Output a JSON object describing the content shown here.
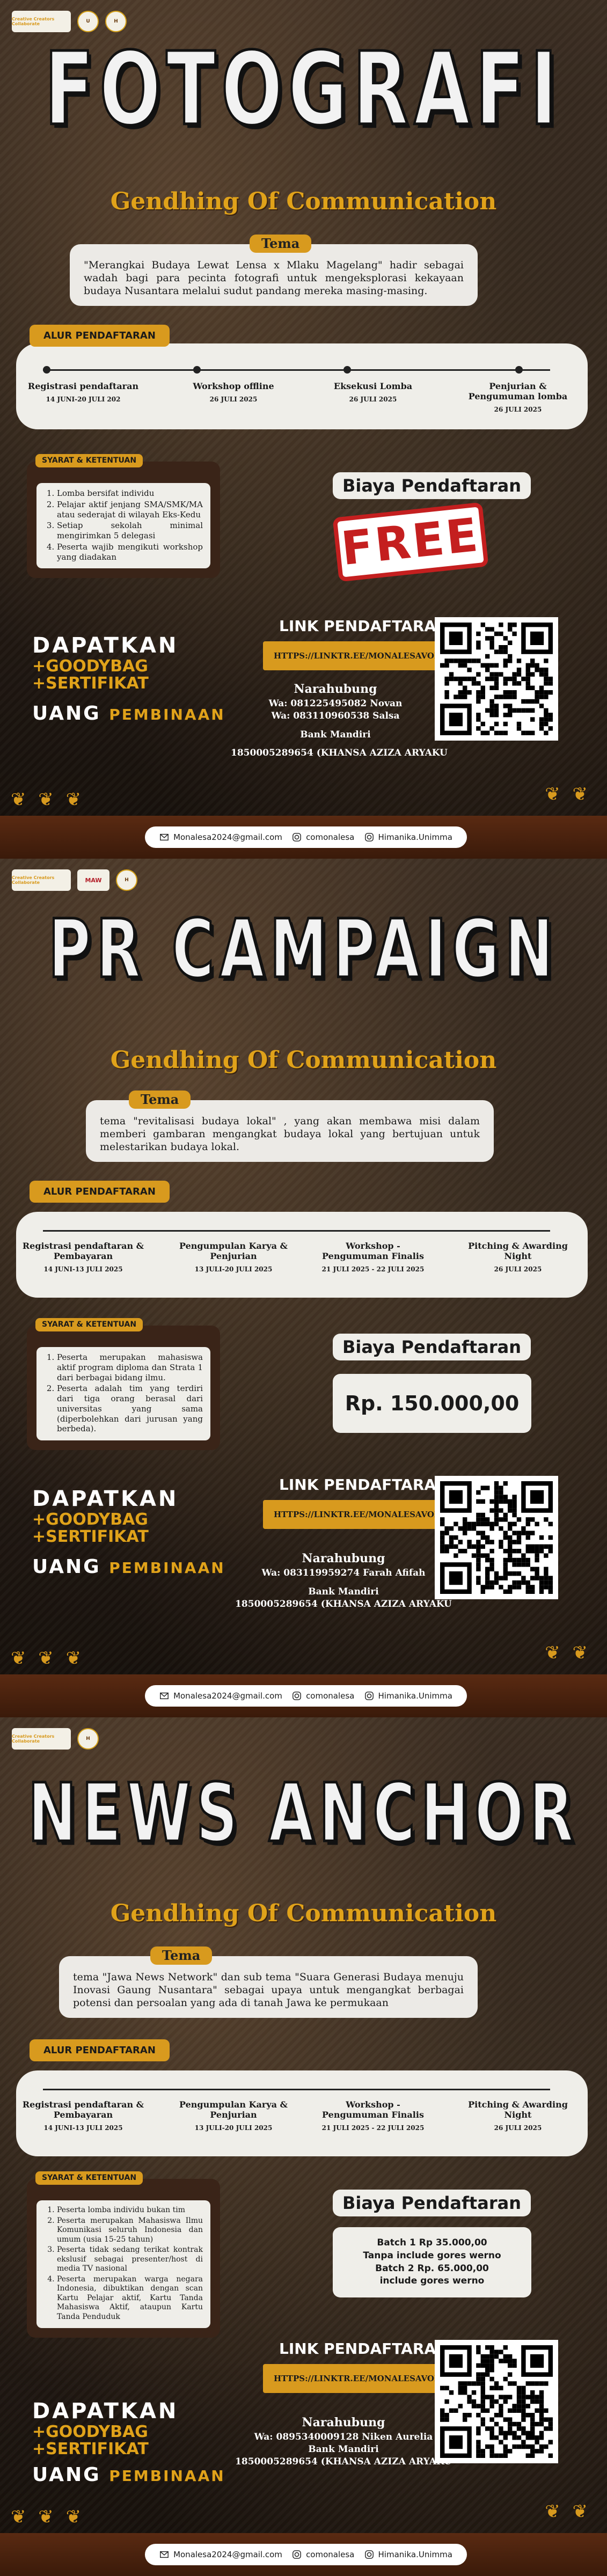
{
  "logos": {
    "creative_label": "Creative Creators Collaborate",
    "maw_label": "MAW"
  },
  "posters": [
    {
      "title": "FOTOGRAFI",
      "subtitle": "Gendhing Of Communication",
      "tema_label": "Tema",
      "tema_text": "\"Merangkai Budaya Lewat Lensa x Mlaku Magelang\" hadir sebagai wadah bagi para pecinta fotografi untuk mengeksplorasi kekayaan budaya Nusantara melalui sudut pandang mereka masing-masing.",
      "alur_label": "ALUR PENDAFTARAN",
      "steps": [
        {
          "name": "Registrasi pendaftaran",
          "date": "14 JUNI-20 JULI 202"
        },
        {
          "name": "Workshop offline",
          "date": "26 JULI 2025"
        },
        {
          "name": "Eksekusi Lomba",
          "date": "26 JULI 2025"
        },
        {
          "name": "Penjurian & Pengumuman lomba",
          "date": "26 JULI 2025"
        }
      ],
      "syarat_label": "SYARAT & KETENTUAN",
      "syarat": [
        "Lomba bersifat individu",
        "Pelajar aktif jenjang SMA/SMK/MA atau sederajat di wilayah Eks-Kedu",
        "Setiap sekolah minimal mengirimkan 5 delegasi",
        "Peserta wajib mengikuti workshop yang diadakan"
      ],
      "biaya_label": "Biaya Pendaftaran",
      "biaya_value": "FREE",
      "dapatkan": "DAPATKAN",
      "goodybag": "+GOODYBAG",
      "sertifikat": "+SERTIFIKAT",
      "uang": "UANG",
      "pembinaan": "PEMBINAAN",
      "link_title": "LINK PENDAFTARAN",
      "link_url": "HTTPS://LINKTR.EE/MONALESAVOL.4",
      "narahubung_label": "Narahubung",
      "narahubung": [
        "Wa: 081225495082 Novan",
        "Wa: 083110960538 Salsa"
      ],
      "bank_label": "Bank Mandiri",
      "bank_account": "1850005289654 (KHANSA AZIZA ARYAKU"
    },
    {
      "title": "PR CAMPAIGN",
      "subtitle": "Gendhing Of Communication",
      "tema_label": "Tema",
      "tema_text": "tema \"revitalisasi budaya lokal\" , yang akan membawa misi dalam memberi gambaran mengangkat budaya lokal yang bertujuan untuk melestarikan budaya lokal.",
      "alur_label": "ALUR PENDAFTARAN",
      "steps": [
        {
          "name": "Registrasi pendaftaran & Pembayaran",
          "date": "14 JUNI-13 JULI 2025"
        },
        {
          "name": "Pengumpulan Karya & Penjurian",
          "date": "13 JULI-20 JULI 2025"
        },
        {
          "name": "Workshop - Pengumuman Finalis",
          "date": "21 JULI 2025 - 22 JULI 2025"
        },
        {
          "name": "Pitching & Awarding Night",
          "date": "26 JULI 2025"
        }
      ],
      "syarat_label": "SYARAT & KETENTUAN",
      "syarat": [
        "Peserta merupakan mahasiswa aktif program diploma dan Strata 1 dari berbagai bidang ilmu.",
        "Peserta adalah tim yang terdiri dari tiga orang berasal dari universitas yang sama (diperbolehkan dari jurusan yang berbeda)."
      ],
      "biaya_label": "Biaya Pendaftaran",
      "biaya_value": "Rp. 150.000,00",
      "dapatkan": "DAPATKAN",
      "goodybag": "+GOODYBAG",
      "sertifikat": "+SERTIFIKAT",
      "uang": "UANG",
      "pembinaan": "PEMBINAAN",
      "link_title": "LINK PENDAFTARAN",
      "link_url": "HTTPS://LINKTR.EE/MONALESAVOL.4",
      "narahubung_label": "Narahubung",
      "narahubung": [
        "Wa: 083119959274 Farah Afifah"
      ],
      "bank_label": "Bank Mandiri",
      "bank_account": "1850005289654 (KHANSA AZIZA ARYAKU"
    },
    {
      "title": "NEWS ANCHOR",
      "subtitle": "Gendhing Of Communication",
      "tema_label": "Tema",
      "tema_text": "tema \"Jawa News Network\" dan sub tema \"Suara Generasi Budaya menuju Inovasi Gaung Nusantara\" sebagai upaya untuk mengangkat berbagai potensi dan persoalan yang ada di tanah Jawa ke permukaan",
      "alur_label": "ALUR PENDAFTARAN",
      "steps": [
        {
          "name": "Registrasi pendaftaran & Pembayaran",
          "date": "14 JUNI-13 JULI 2025"
        },
        {
          "name": "Pengumpulan Karya & Penjurian",
          "date": "13 JULI-20 JULI 2025"
        },
        {
          "name": "Workshop - Pengumuman Finalis",
          "date": "21 JULI 2025 - 22 JULI 2025"
        },
        {
          "name": "Pitching & Awarding Night",
          "date": "26 JULI 2025"
        }
      ],
      "syarat_label": "SYARAT & KETENTUAN",
      "syarat": [
        "Peserta lomba individu bukan tim",
        "Peserta merupakan Mahasiswa Ilmu Komunikasi seluruh Indonesia dan umum (usia 15-25 tahun)",
        "Peserta tidak sedang terikat kontrak ekslusif sebagai presenter/host di media TV nasional",
        "Peserta merupakan warga negara Indonesia, dibuktikan dengan scan Kartu Pelajar aktif, Kartu Tanda Mahasiswa Aktif, ataupun Kartu Tanda Penduduk"
      ],
      "biaya_label": "Biaya Pendaftaran",
      "biaya_lines": [
        "Batch 1 Rp 35.000,00",
        "Tanpa include gores werno",
        "Batch 2 Rp. 65.000,00",
        "include gores werno"
      ],
      "dapatkan": "DAPATKAN",
      "goodybag": "+GOODYBAG",
      "sertifikat": "+SERTIFIKAT",
      "uang": "UANG",
      "pembinaan": "PEMBINAAN",
      "link_title": "LINK PENDAFTARAN",
      "link_url": "HTTPS://LINKTR.EE/MONALESAVOL.4",
      "narahubung_label": "Narahubung",
      "narahubung": [
        "Wa: 0895340009128 Niken Aurelia"
      ],
      "bank_label": "Bank Mandiri",
      "bank_account": "1850005289654 (KHANSA AZIZA ARYAKU"
    }
  ],
  "footer": {
    "email": "Monalesa2024@gmail.com",
    "instagram": "comonalesa",
    "himanika": "Himanika.Unimma"
  },
  "colors": {
    "accent": "#d89a1e",
    "dark": "#1f1711",
    "light": "#efeee9",
    "stamp": "#c41f1f"
  }
}
